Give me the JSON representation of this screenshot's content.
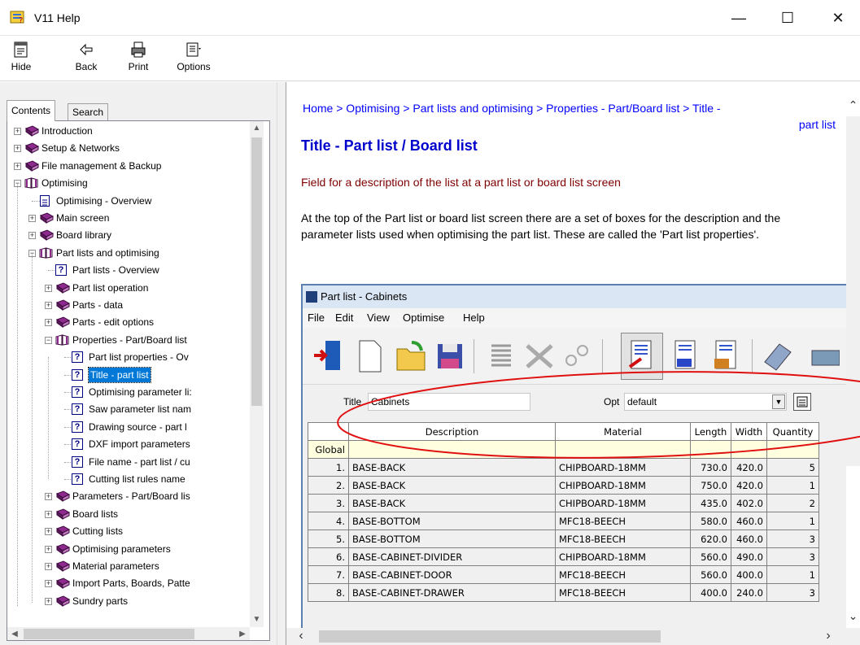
{
  "window": {
    "title": "V11 Help",
    "controls": {
      "minimize": "—",
      "maximize": "☐",
      "close": "✕"
    }
  },
  "toolbar": {
    "hide": "Hide",
    "back": "Back",
    "print": "Print",
    "options": "Options"
  },
  "tabs": {
    "contents": "Contents",
    "search": "Search"
  },
  "tree": [
    {
      "label": "Introduction",
      "level": 0,
      "type": "book",
      "exp": "+"
    },
    {
      "label": "Setup & Networks",
      "level": 0,
      "type": "book",
      "exp": "+"
    },
    {
      "label": "File management & Backup",
      "level": 0,
      "type": "book",
      "exp": "+"
    },
    {
      "label": "Optimising",
      "level": 0,
      "type": "openbook",
      "exp": "-"
    },
    {
      "label": "Optimising - Overview",
      "level": 1,
      "type": "page"
    },
    {
      "label": "Main screen",
      "level": 1,
      "type": "book",
      "exp": "+"
    },
    {
      "label": "Board library",
      "level": 1,
      "type": "book",
      "exp": "+"
    },
    {
      "label": "Part lists and optimising",
      "level": 1,
      "type": "openbook",
      "exp": "-"
    },
    {
      "label": "Part lists - Overview",
      "level": 2,
      "type": "q"
    },
    {
      "label": "Part list operation",
      "level": 2,
      "type": "book",
      "exp": "+"
    },
    {
      "label": "Parts - data",
      "level": 2,
      "type": "book",
      "exp": "+"
    },
    {
      "label": "Parts - edit options",
      "level": 2,
      "type": "book",
      "exp": "+"
    },
    {
      "label": "Properties - Part/Board list",
      "level": 2,
      "type": "openbook",
      "exp": "-"
    },
    {
      "label": "Part list properties - Ov",
      "level": 3,
      "type": "q"
    },
    {
      "label": "Title - part list",
      "level": 3,
      "type": "q",
      "selected": true
    },
    {
      "label": "Optimising parameter li:",
      "level": 3,
      "type": "q"
    },
    {
      "label": "Saw parameter list nam",
      "level": 3,
      "type": "q"
    },
    {
      "label": "Drawing source - part l",
      "level": 3,
      "type": "q"
    },
    {
      "label": "DXF import parameters",
      "level": 3,
      "type": "q"
    },
    {
      "label": "File name - part list / cu",
      "level": 3,
      "type": "q"
    },
    {
      "label": "Cutting list rules name",
      "level": 3,
      "type": "q"
    },
    {
      "label": "Parameters - Part/Board lis",
      "level": 2,
      "type": "book",
      "exp": "+"
    },
    {
      "label": "Board lists",
      "level": 2,
      "type": "book",
      "exp": "+"
    },
    {
      "label": "Cutting lists",
      "level": 2,
      "type": "book",
      "exp": "+"
    },
    {
      "label": "Optimising parameters",
      "level": 2,
      "type": "book",
      "exp": "+"
    },
    {
      "label": "Material parameters",
      "level": 2,
      "type": "book",
      "exp": "+"
    },
    {
      "label": "Import Parts, Boards, Patte",
      "level": 2,
      "type": "book",
      "exp": "+"
    },
    {
      "label": "Sundry parts",
      "level": 2,
      "type": "book",
      "exp": "+"
    }
  ],
  "content": {
    "breadcrumb_first": "Home > Optimising > Part lists and optimising > Properties - Part/Board list > Title -",
    "breadcrumb_second": "part list",
    "heading": "Title - Part list / Board list",
    "description": "Field for a description of the list at a part list or board list screen",
    "paragraph": "At the top of the Part list or board list screen there are a set of boxes for the description and the parameter lists used when optimising the part list. These are called the 'Part list properties'."
  },
  "partlist_window": {
    "title": "Part list - Cabinets",
    "menu": [
      "File",
      "Edit",
      "View",
      "Optimise",
      "Help"
    ],
    "title_label": "Title",
    "title_value": "Cabinets",
    "opt_label": "Opt",
    "opt_value": "default",
    "columns": [
      "",
      "Description",
      "Material",
      "Length",
      "Width",
      "Quantity"
    ],
    "global_label": "Global",
    "rows": [
      [
        "1.",
        "BASE-BACK",
        "CHIPBOARD-18MM",
        "730.0",
        "420.0",
        "5"
      ],
      [
        "2.",
        "BASE-BACK",
        "CHIPBOARD-18MM",
        "750.0",
        "420.0",
        "1"
      ],
      [
        "3.",
        "BASE-BACK",
        "CHIPBOARD-18MM",
        "435.0",
        "402.0",
        "2"
      ],
      [
        "4.",
        "BASE-BOTTOM",
        "MFC18-BEECH",
        "580.0",
        "460.0",
        "1"
      ],
      [
        "5.",
        "BASE-BOTTOM",
        "MFC18-BEECH",
        "620.0",
        "460.0",
        "3"
      ],
      [
        "6.",
        "BASE-CABINET-DIVIDER",
        "CHIPBOARD-18MM",
        "560.0",
        "490.0",
        "3"
      ],
      [
        "7.",
        "BASE-CABINET-DOOR",
        "MFC18-BEECH",
        "560.0",
        "400.0",
        "1"
      ],
      [
        "8.",
        "BASE-CABINET-DRAWER",
        "MFC18-BEECH",
        "400.0",
        "240.0",
        "3"
      ]
    ]
  },
  "colors": {
    "link": "#0000ff",
    "heading": "#0000cc",
    "desc": "#800000",
    "highlight": "#e01010",
    "selection": "#0078d7"
  }
}
